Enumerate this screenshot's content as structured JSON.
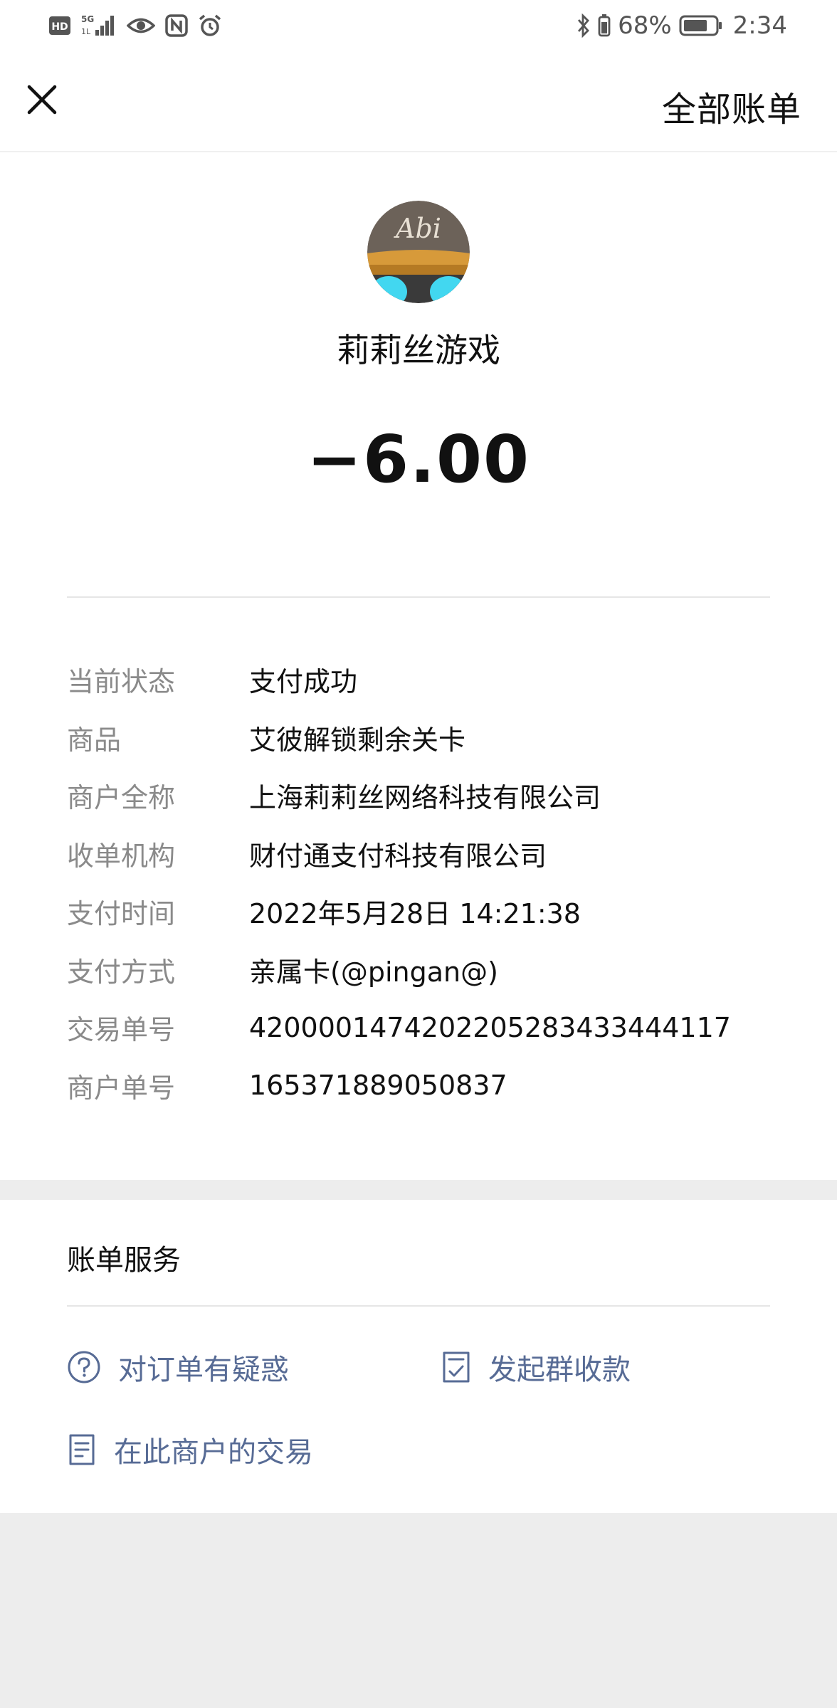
{
  "status_bar": {
    "battery": "68%",
    "time": "2:34",
    "icons": [
      "hd-icon",
      "signal-5g-icon",
      "eye-icon",
      "nfc-icon",
      "alarm-icon",
      "bluetooth-icon",
      "battery-icon"
    ]
  },
  "nav": {
    "close_icon": "close-icon",
    "all_bills": "全部账单"
  },
  "merchant": {
    "avatar_text": "Abi",
    "name": "莉莉丝游戏",
    "amount": "−6.00"
  },
  "details": [
    {
      "key": "当前状态",
      "value": "支付成功"
    },
    {
      "key": "商品",
      "value": "艾彼解锁剩余关卡"
    },
    {
      "key": "商户全称",
      "value": "上海莉莉丝网络科技有限公司"
    },
    {
      "key": "收单机构",
      "value": "财付通支付科技有限公司"
    },
    {
      "key": "支付时间",
      "value": "2022年5月28日 14:21:38"
    },
    {
      "key": "支付方式",
      "value": "亲属卡(@pingan@)"
    },
    {
      "key": "交易单号",
      "value": "4200001474202205283433444117"
    },
    {
      "key": "商户单号",
      "value": "165371889050837"
    }
  ],
  "services": {
    "title": "账单服务",
    "items": [
      {
        "label": "对订单有疑惑",
        "icon": "question-circle-icon"
      },
      {
        "label": "发起群收款",
        "icon": "checklist-icon"
      },
      {
        "label": "在此商户的交易",
        "icon": "document-icon"
      }
    ]
  },
  "colors": {
    "link": "#576b95",
    "muted": "#8a8a8a",
    "background": "#ededed"
  }
}
